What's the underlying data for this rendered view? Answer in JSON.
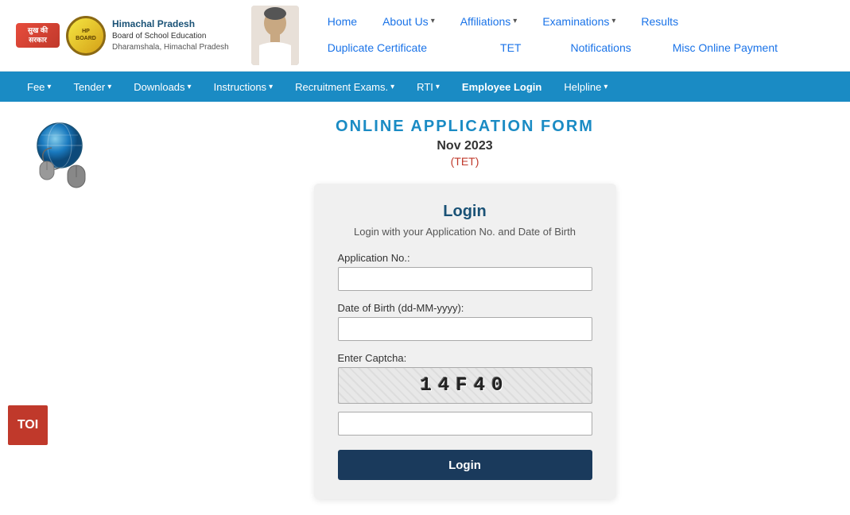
{
  "header": {
    "org_line1": "Himachal Pradesh",
    "org_line2": "Board of School Education",
    "org_line3": "Dharamshala, Himachal Pradesh",
    "govt_label": "सुख की\nसरकार",
    "logo_alt": "HP Board Logo"
  },
  "top_nav_row1": {
    "items": [
      {
        "label": "Home",
        "has_dropdown": false,
        "active": true
      },
      {
        "label": "About Us",
        "has_dropdown": true,
        "active": false
      },
      {
        "label": "Affiliations",
        "has_dropdown": true,
        "active": false
      },
      {
        "label": "Examinations",
        "has_dropdown": true,
        "active": false
      },
      {
        "label": "Results",
        "has_dropdown": false,
        "active": false
      }
    ]
  },
  "top_nav_row2": {
    "items": [
      {
        "label": "Duplicate Certificate",
        "has_dropdown": false
      },
      {
        "label": "TET",
        "has_dropdown": false
      },
      {
        "label": "Notifications",
        "has_dropdown": false
      },
      {
        "label": "Misc Online Payment",
        "has_dropdown": false
      }
    ]
  },
  "blue_nav": {
    "items": [
      {
        "label": "Fee",
        "has_dropdown": true
      },
      {
        "label": "Tender",
        "has_dropdown": true
      },
      {
        "label": "Downloads",
        "has_dropdown": true
      },
      {
        "label": "Instructions",
        "has_dropdown": true
      },
      {
        "label": "Recruitment Exams.",
        "has_dropdown": true
      },
      {
        "label": "RTI",
        "has_dropdown": true
      },
      {
        "label": "Employee Login",
        "has_dropdown": false,
        "highlight": true
      },
      {
        "label": "Helpline",
        "has_dropdown": true
      }
    ]
  },
  "page": {
    "form_title": "ONLINE APPLICATION FORM",
    "form_date": "Nov 2023",
    "form_type": "(TET)"
  },
  "login_form": {
    "title": "Login",
    "subtitle": "Login with your Application No. and Date of Birth",
    "field1_label": "Application No.:",
    "field1_placeholder": "",
    "field2_label": "Date of Birth (dd-MM-yyyy):",
    "field2_placeholder": "",
    "captcha_label": "Enter Captcha:",
    "captcha_value": "14F40",
    "captcha_input_placeholder": "",
    "submit_label": "Login"
  },
  "toi": {
    "label": "TOI"
  }
}
